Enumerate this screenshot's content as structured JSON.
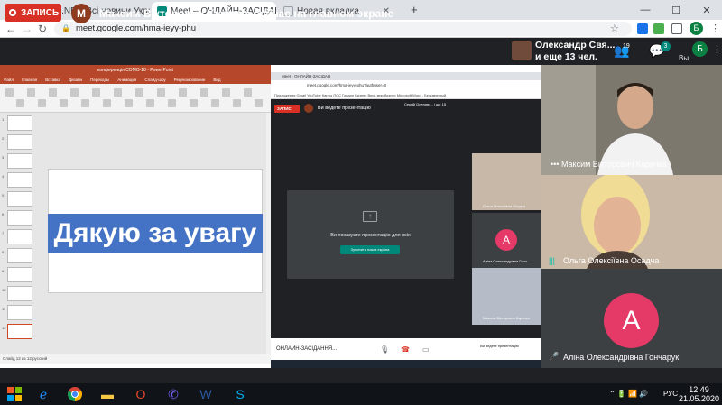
{
  "browser": {
    "tabs": [
      {
        "title": "UKR.NET: Всі новини України, о",
        "color": "#ffd600"
      },
      {
        "title": "Meet – ОНЛАЙН-ЗАСІДАНН",
        "color": "#00897b"
      },
      {
        "title": "Новая вкладка",
        "color": "#5f6368"
      }
    ],
    "new_tab": "+",
    "url": "meet.google.com/hma-ieyy-phu",
    "profile_initial": "Б"
  },
  "meet": {
    "record_label": "ЗАПИСЬ",
    "presenter_initial": "M",
    "presenter_title": "Максим Вікторович Карячка сейчас на главном экране",
    "host_name": "Олександр Свя...",
    "host_more": "и еще 13 чел.",
    "participants_count": "19",
    "chat_count": "3",
    "you_label": "Вы",
    "you_initial": "Б"
  },
  "presentation": {
    "ppt_title": "конференція СОМО-18 - PowerPoint",
    "ppt_menu": [
      "Файл",
      "Главная",
      "Вставка",
      "Дизайн",
      "Переходы",
      "Анимация",
      "Слайд-шоу",
      "Рецензирование",
      "Вид"
    ],
    "slide_numbers": [
      "1",
      "2",
      "3",
      "4",
      "5",
      "6",
      "7",
      "8",
      "9",
      "10",
      "11",
      "12"
    ],
    "slide_text": "Дякую за увагу",
    "status_text": "Слайд 12 из 12   русский",
    "nested_tab": "Meet - ОНЛАЙН-ЗАСІДАН",
    "nested_url": "meet.google.com/hma-ieyy-phu?authuser=0",
    "nested_bookmarks": "Приложения  Gmail  YouTube  Карты  ПСС Гордон Бизнес  Весь мир бизнес  Microsoft Word - Безымянный",
    "nested_record": "ЗАПИС",
    "nested_presenting": "Ви ведете презентацію",
    "nested_host": "Сергій Олегови...\nі ще 15",
    "nested_card_text": "Ви показуєте презентацію для всіх",
    "nested_card_button": "Зупинити показ екрана",
    "nested_tiles": [
      "Ольга Олексіївна Осадча",
      "Аліна Олександрівна Гонч...",
      "Максим Вікторович Карячка"
    ],
    "nested_avatar": "A",
    "nested_meeting_name": "ОНЛАЙН-ЗАСІДАННЯ...",
    "nested_presenting_bottom": "Ви ведете презентацію"
  },
  "participants": [
    {
      "name": "Максим Вікторович Карячка"
    },
    {
      "name": "Ольга Олексіївна Осадча"
    },
    {
      "name": "Аліна Олександрівна Гончарук",
      "initial": "A",
      "color": "#e53968"
    }
  ],
  "taskbar": {
    "lang": "РУС",
    "time": "12:49",
    "date": "21.05.2020"
  }
}
